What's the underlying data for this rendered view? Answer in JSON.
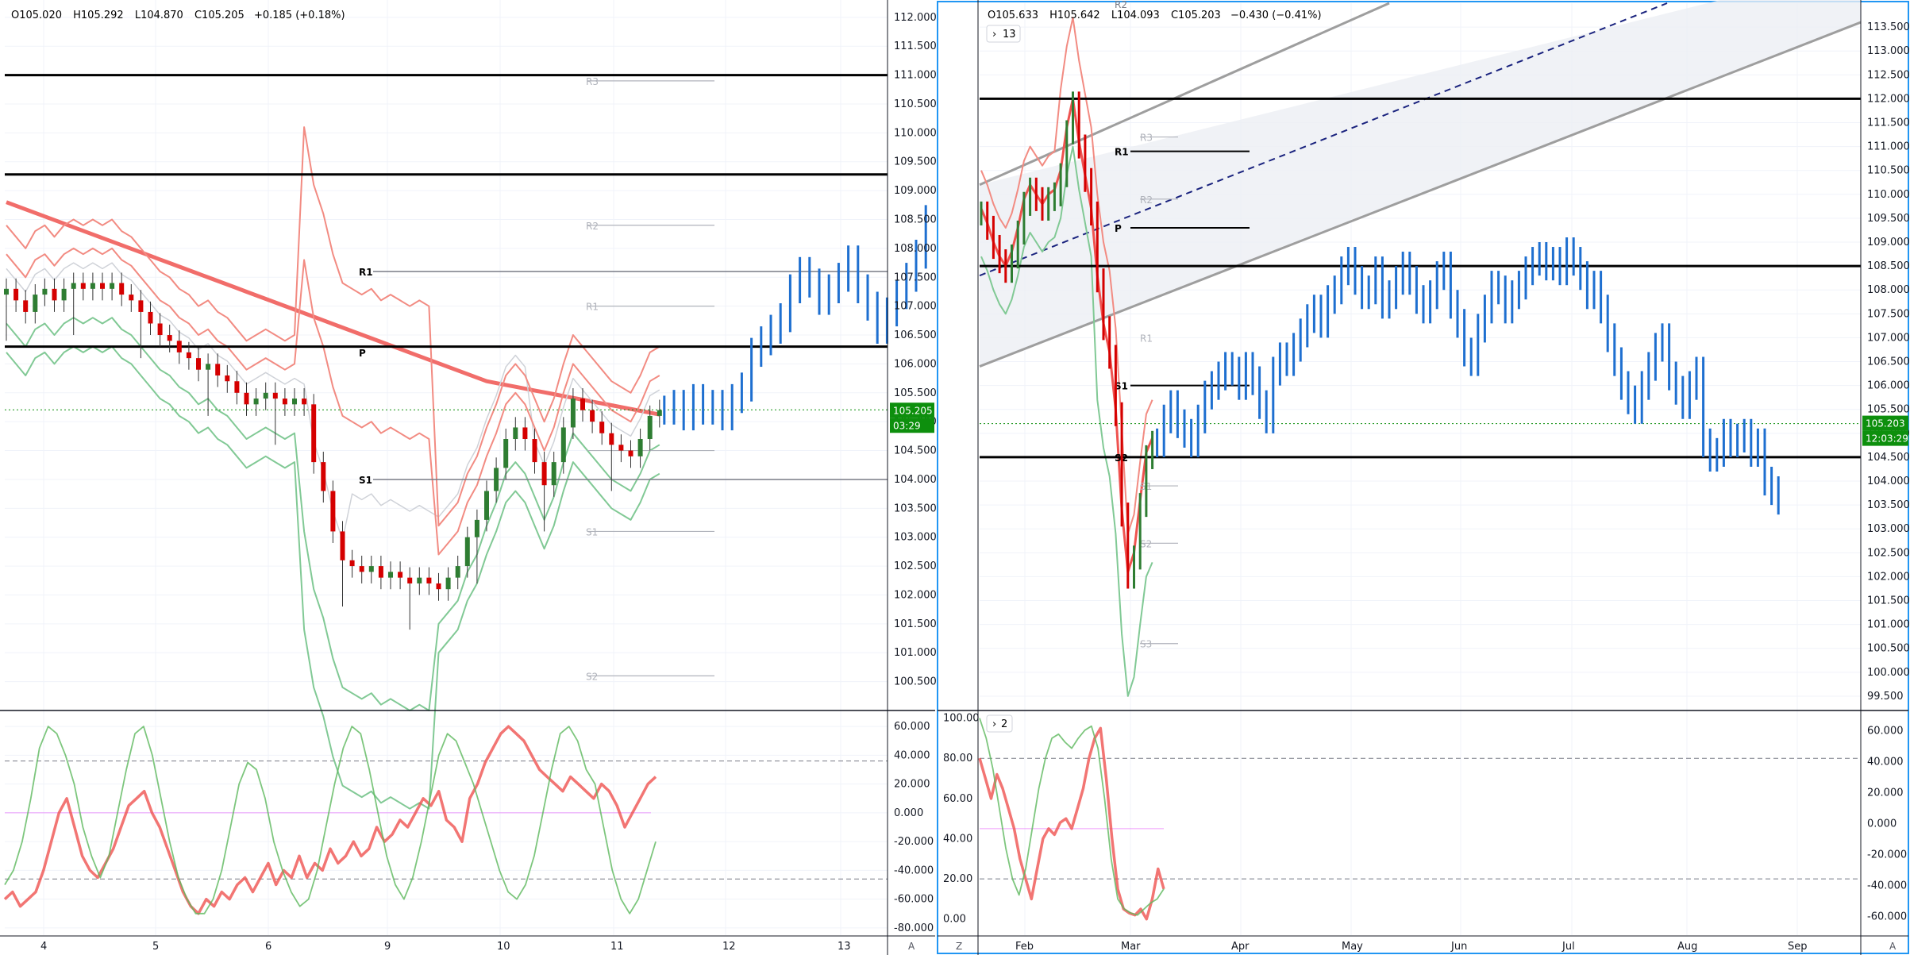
{
  "colors": {
    "up": "#26a69a",
    "down": "#ef5350",
    "candle_up": "#2e7d32",
    "candle_down": "#d50000",
    "projection": "#1e6fd0",
    "bb_upper": "#f28b82",
    "bb_lower": "#81c995",
    "ma_red": "#ef5350",
    "ma_green": "#5cb85c",
    "price_tag": "#0d8f0d",
    "channel_fill": "#eceff4",
    "channel_line": "#9e9e9e",
    "dash_line": "#1a237e"
  },
  "left_panel": {
    "ohlc": {
      "o": "O105.020",
      "h": "H105.292",
      "l": "L104.870",
      "c": "C105.205",
      "chg": "+0.185 (+0.18%)"
    },
    "price_tag": "105.205",
    "countdown": "03:29",
    "x_ticks": [
      "4",
      "5",
      "6",
      "9",
      "10",
      "11",
      "12",
      "13"
    ],
    "corner_label": "A",
    "pivot_labels": {
      "r1_black": "R1",
      "s1_black": "S1",
      "r3": "R3",
      "r2": "R2",
      "r1": "R1",
      "s1": "S1",
      "s2": "S2",
      "p": "P"
    }
  },
  "right_panel": {
    "ohlc": {
      "o": "O105.633",
      "h": "H105.642",
      "l": "L104.093",
      "c": "C105.203",
      "chg": "−0.430 (−0.41%)"
    },
    "badge": "13",
    "osc_badge": "2",
    "price_tag": "105.203",
    "countdown": "12:03:29",
    "x_ticks": [
      "Feb",
      "Mar",
      "Apr",
      "May",
      "Jun",
      "Jul",
      "Aug",
      "Sep"
    ],
    "corner_left": "Z",
    "corner_right": "A",
    "pivot_labels": {
      "r1": "R1",
      "p": "P",
      "s1": "S1",
      "s2": "S2",
      "r3g": "R3",
      "r2g": "R2",
      "s1g": "S1",
      "s2g": "S2",
      "s3g": "S3",
      "r2top": "R2",
      "r1g": "R1"
    }
  },
  "chart_data": [
    {
      "type": "candlestick",
      "panel": "left-price",
      "y_ticks": [
        "112.000",
        "111.500",
        "111.000",
        "110.500",
        "110.000",
        "109.500",
        "109.000",
        "108.500",
        "108.000",
        "107.500",
        "107.000",
        "106.500",
        "106.000",
        "105.500",
        "105.000",
        "104.500",
        "104.000",
        "103.500",
        "103.000",
        "102.500",
        "102.000",
        "101.500",
        "101.000",
        "100.500"
      ],
      "ylim": [
        100.0,
        112.3
      ],
      "x_ticks": [
        "4",
        "5",
        "6",
        "9",
        "10",
        "11",
        "12",
        "13"
      ],
      "horizontal_lines": [
        111.0,
        109.28,
        106.3
      ],
      "pivots": {
        "R3": 110.9,
        "R2": 108.4,
        "R1": 107.0,
        "S1": 103.1,
        "S2": 100.6,
        "R1_black": 107.6,
        "S1_black": 104.0
      },
      "close_path": [
        107.3,
        107.1,
        106.9,
        107.2,
        107.3,
        107.1,
        107.3,
        107.4,
        107.3,
        107.4,
        107.3,
        107.4,
        107.2,
        107.1,
        106.9,
        106.7,
        106.5,
        106.4,
        106.2,
        106.1,
        105.9,
        106.0,
        105.8,
        105.7,
        105.5,
        105.3,
        105.4,
        105.5,
        105.4,
        105.3,
        105.4,
        105.3,
        104.3,
        103.8,
        103.1,
        102.6,
        102.5,
        102.4,
        102.5,
        102.3,
        102.4,
        102.3,
        102.2,
        102.3,
        102.2,
        102.1,
        102.3,
        102.5,
        103.0,
        103.3,
        103.8,
        104.2,
        104.7,
        104.9,
        104.7,
        104.3,
        103.9,
        104.3,
        104.9,
        105.4,
        105.2,
        105.0,
        104.8,
        104.6,
        104.5,
        104.4,
        104.7,
        105.1,
        105.2
      ],
      "projection_path": [
        105.2,
        105.3,
        105.1,
        105.4,
        105.2,
        105.3,
        105.1,
        105.4,
        105.6,
        106.2,
        106.4,
        106.6,
        106.8,
        107.3,
        107.6,
        107.4,
        107.1,
        107.3,
        107.5,
        107.8,
        107.3,
        107.0,
        106.6,
        106.9,
        107.2,
        107.5,
        107.9,
        108.5
      ]
    },
    {
      "type": "line",
      "panel": "left-oscillator",
      "y_ticks": [
        "60.000",
        "40.000",
        "20.000",
        "0.000",
        "-20.000",
        "-40.000",
        "-60.000",
        "-80.000"
      ],
      "ylim": [
        -85,
        70
      ],
      "levels": [
        36,
        -46
      ],
      "series": [
        {
          "values": [
            -60,
            -55,
            -65,
            -60,
            -55,
            -40,
            -20,
            0,
            10,
            -10,
            -30,
            -40,
            -45,
            -35,
            -25,
            -10,
            5,
            10,
            15,
            0,
            -10,
            -25,
            -40,
            -55,
            -65,
            -70,
            -60,
            -65,
            -55,
            -60,
            -50,
            -45,
            -55,
            -45,
            -35,
            -50,
            -40,
            -45,
            -30,
            -45,
            -35,
            -40,
            -25,
            -35,
            -30,
            -20,
            -30,
            -25,
            -10,
            -20,
            -15,
            -5,
            -10,
            0,
            10,
            5,
            15,
            -5,
            -10,
            -20,
            10,
            20,
            35,
            45,
            55,
            60,
            55,
            50,
            40,
            30,
            25,
            20,
            15,
            25,
            20,
            15,
            10,
            20,
            15,
            5,
            -10,
            0,
            10,
            20,
            25
          ]
        },
        {
          "values": [
            -50,
            -40,
            -20,
            10,
            45,
            60,
            55,
            40,
            20,
            -10,
            -30,
            -45,
            -30,
            0,
            30,
            55,
            60,
            40,
            10,
            -20,
            -45,
            -60,
            -70,
            -70,
            -60,
            -40,
            -10,
            20,
            35,
            30,
            10,
            -20,
            -40,
            -55,
            -65,
            -60,
            -40,
            -10,
            20,
            45,
            60,
            55,
            30,
            0,
            -30,
            -50,
            -60,
            -45,
            -20,
            10,
            40,
            55,
            50,
            35,
            20,
            0,
            -20,
            -40,
            -55,
            -60,
            -50,
            -30,
            0,
            30,
            55,
            60,
            50,
            30,
            20,
            -10,
            -40,
            -60,
            -70,
            -60,
            -40,
            -20
          ]
        }
      ]
    },
    {
      "type": "ohlc",
      "panel": "right-price",
      "y_ticks": [
        "113.500",
        "113.000",
        "112.500",
        "112.000",
        "111.500",
        "111.000",
        "110.500",
        "110.000",
        "109.500",
        "109.000",
        "108.500",
        "108.000",
        "107.500",
        "107.000",
        "106.500",
        "106.000",
        "105.500",
        "105.000",
        "104.500",
        "104.000",
        "103.500",
        "103.000",
        "102.500",
        "102.000",
        "101.500",
        "101.000",
        "100.500",
        "100.000",
        "99.500"
      ],
      "ylim": [
        99.2,
        114.0
      ],
      "x_ticks": [
        "Feb",
        "Mar",
        "Apr",
        "May",
        "Jun",
        "Jul",
        "Aug",
        "Sep"
      ],
      "horizontal_lines": [
        112.0,
        108.5,
        104.5
      ],
      "pivots": {
        "R1": 110.9,
        "P": 109.3,
        "S1": 106.0,
        "S2": 104.5,
        "R3": 111.2,
        "R2": 109.9,
        "S1_gray": 103.9,
        "S2_gray": 102.7,
        "S3": 100.6
      },
      "history_path": [
        109.6,
        109.3,
        108.9,
        108.6,
        108.4,
        108.7,
        109.2,
        109.8,
        110.1,
        109.9,
        109.7,
        109.9,
        110.0,
        110.4,
        111.3,
        111.9,
        111.0,
        110.3,
        109.6,
        108.2,
        107.2,
        106.6,
        105.4,
        103.3,
        102.0,
        102.4,
        103.5,
        104.5,
        104.8
      ],
      "projection_path": [
        104.8,
        105.3,
        105.6,
        105.2,
        105.0,
        104.8,
        105.3,
        105.8,
        106.0,
        106.2,
        106.4,
        106.3,
        106.0,
        106.4,
        106.1,
        105.6,
        105.3,
        106.3,
        106.6,
        106.5,
        106.8,
        107.1,
        107.4,
        107.6,
        107.3,
        107.8,
        108.0,
        108.4,
        108.6,
        108.2,
        107.9,
        108.0,
        108.4,
        107.7,
        107.9,
        108.2,
        108.5,
        108.2,
        107.8,
        107.6,
        107.9,
        108.3,
        108.5,
        107.7,
        107.3,
        106.7,
        106.5,
        107.2,
        107.6,
        108.1,
        108.0,
        107.6,
        107.9,
        108.1,
        108.4,
        108.6,
        108.7,
        108.5,
        108.6,
        108.4,
        108.8,
        108.6,
        108.3,
        107.9,
        108.1,
        107.6,
        107.0,
        106.5,
        106.0,
        105.7,
        105.5,
        106.0,
        106.4,
        106.8,
        107.0,
        106.2,
        105.9,
        105.6,
        106.0,
        106.3,
        104.8,
        104.5,
        104.6,
        105.0,
        104.8,
        104.9,
        105.0,
        104.6,
        104.8,
        104.0,
        103.8,
        103.6
      ]
    },
    {
      "type": "line",
      "panel": "right-oscillator",
      "y_ticks_left": [
        "100.00",
        "80.00",
        "60.00",
        "40.00",
        "20.00",
        "0.00"
      ],
      "y_ticks_right": [
        "60.000",
        "40.000",
        "20.000",
        "0.000",
        "-20.000",
        "-40.000",
        "-60.000"
      ],
      "ylim": [
        -8,
        103
      ],
      "levels": [
        80,
        20
      ],
      "series": [
        {
          "values": [
            80,
            70,
            60,
            72,
            65,
            55,
            45,
            30,
            20,
            10,
            25,
            40,
            45,
            42,
            48,
            50,
            45,
            55,
            65,
            80,
            90,
            95,
            70,
            40,
            15,
            5,
            3,
            2,
            5,
            0,
            10,
            25,
            15
          ]
        },
        {
          "values": [
            100,
            90,
            75,
            55,
            35,
            20,
            12,
            25,
            45,
            65,
            80,
            90,
            92,
            88,
            85,
            90,
            94,
            96,
            85,
            60,
            30,
            10,
            5,
            3,
            2,
            5,
            8,
            10,
            15
          ]
        }
      ]
    }
  ]
}
